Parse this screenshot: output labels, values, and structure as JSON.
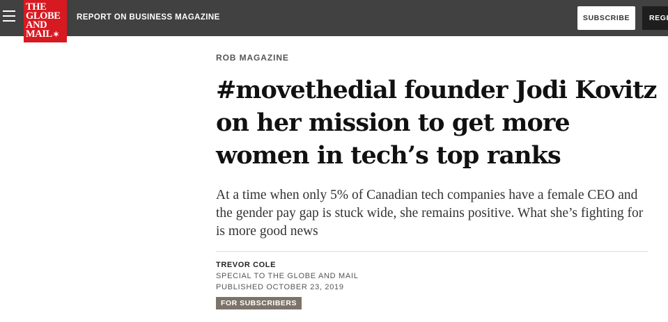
{
  "header": {
    "logo_lines": [
      "THE",
      "GLOBE",
      "AND",
      "MAIL"
    ],
    "section_link": "REPORT ON BUSINESS MAGAZINE",
    "subscribe_label": "SUBSCRIBE",
    "register_label": "REGISTER",
    "colors": {
      "bar": "#414141",
      "logo": "#d71921"
    }
  },
  "article": {
    "kicker": "ROB MAGAZINE",
    "headline": "#movethedial founder Jodi Kovitz on her mission to get more women in tech’s top ranks",
    "dek": "At a time when only 5% of Canadian tech companies have a female CEO and the gender pay gap is stuck wide, she remains positive. What she’s fighting for is more good news",
    "author": "TREVOR COLE",
    "affiliation": "SPECIAL TO THE GLOBE AND MAIL",
    "published": "PUBLISHED OCTOBER 23, 2019",
    "badge": "FOR SUBSCRIBERS"
  }
}
